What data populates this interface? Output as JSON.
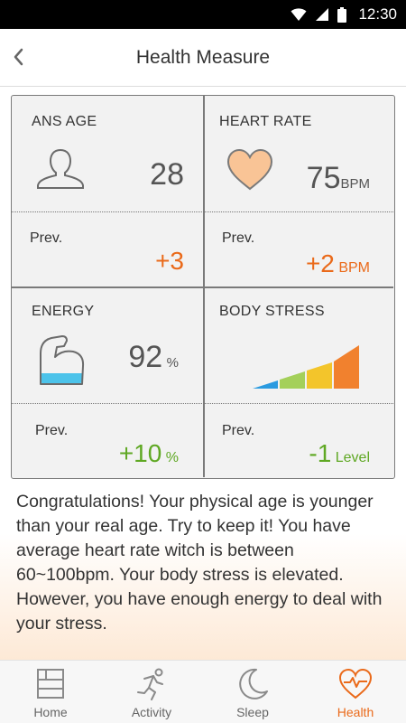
{
  "status_bar": {
    "time": "12:30"
  },
  "app_bar": {
    "title": "Health Measure"
  },
  "metrics": {
    "ans_age": {
      "label": "ANS AGE",
      "value": "28",
      "prev_label": "Prev.",
      "prev_value": "+3"
    },
    "heart_rate": {
      "label": "HEART RATE",
      "value": "75",
      "unit": "BPM",
      "prev_label": "Prev.",
      "prev_value": "+2",
      "prev_unit": "BPM"
    },
    "energy": {
      "label": "ENERGY",
      "value": "92",
      "unit": "%",
      "fill_fraction": 0.35,
      "prev_label": "Prev.",
      "prev_value": "+10",
      "prev_unit": "%"
    },
    "body_stress": {
      "label": "BODY STRESS",
      "level_bars": 4,
      "prev_label": "Prev.",
      "prev_value": "-1",
      "prev_unit": "Level"
    }
  },
  "message": "Congratulations! Your physical age is younger than your real age. Try to keep it! You have average heart rate witch is between 60~100bpm. Your body stress is elevated. However, you have enough energy to deal with your stress.",
  "colors": {
    "accent_orange": "#ea6a1a",
    "accent_green": "#5fa823",
    "heart_fill": "#f9c496",
    "energy_fill": "#4cc3ea",
    "stress_levels": [
      "#2b9be0",
      "#a4d05a",
      "#f3c52b",
      "#f1812e"
    ]
  },
  "bottom_nav": {
    "items": [
      {
        "label": "Home",
        "icon": "home-grid-icon",
        "active": false
      },
      {
        "label": "Activity",
        "icon": "running-person-icon",
        "active": false
      },
      {
        "label": "Sleep",
        "icon": "moon-icon",
        "active": false
      },
      {
        "label": "Health",
        "icon": "heart-pulse-icon",
        "active": true
      }
    ]
  }
}
